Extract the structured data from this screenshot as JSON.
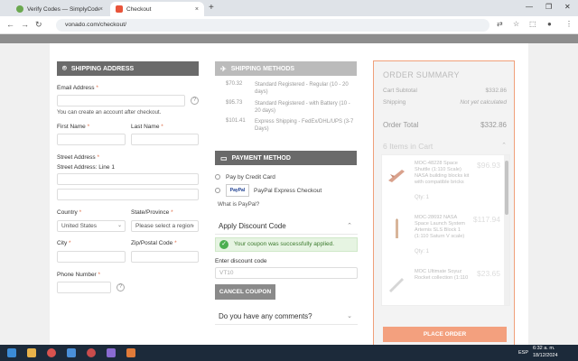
{
  "browser": {
    "tabs": [
      {
        "label": "Verify Codes — SimplyCodes",
        "close": "×"
      },
      {
        "label": "Checkout",
        "close": "×"
      }
    ],
    "new_tab": "+",
    "url": "vonado.com/checkout/"
  },
  "shipping_address": {
    "title": "SHIPPING ADDRESS",
    "email_label": "Email Address",
    "required_mark": "*",
    "account_note": "You can create an account after checkout.",
    "first_name_label": "First Name",
    "last_name_label": "Last Name",
    "street_label": "Street Address",
    "street_sublabel": "Street Address: Line 1",
    "country_label": "Country",
    "country_value": "United States",
    "state_label": "State/Province",
    "state_value": "Please select a region",
    "city_label": "City",
    "zip_label": "Zip/Postal Code",
    "phone_label": "Phone Number",
    "help": "?"
  },
  "shipping_methods": {
    "title": "SHIPPING METHODS",
    "options": [
      {
        "price": "$70.32",
        "desc": "Standard Registered - Regular (10 - 20 days)"
      },
      {
        "price": "$95.73",
        "desc": "Standard Registered - with Battery (10 - 20 days)"
      },
      {
        "price": "$101.41",
        "desc": "Express Shipping - FedEx/DHL/UPS (3-7 Days)"
      }
    ]
  },
  "payment": {
    "title": "PAYMENT METHOD",
    "credit_card": "Pay by Credit Card",
    "paypal": "PayPal Express Checkout",
    "paypal_logo": "PayPal",
    "what_is_paypal": "What is PayPal?"
  },
  "discount": {
    "title": "Apply Discount Code",
    "success": "Your coupon was successfully applied.",
    "enter_label": "Enter discount code",
    "code_value": "VT10",
    "cancel_button": "CANCEL COUPON"
  },
  "comments": {
    "title": "Do you have any comments?"
  },
  "summary": {
    "title": "ORDER SUMMARY",
    "subtotal_label": "Cart Subtotal",
    "subtotal_value": "$332.86",
    "shipping_label": "Shipping",
    "shipping_value": "Not yet calculated",
    "total_label": "Order Total",
    "total_value": "$332.86",
    "cart_heading": "6 Items in Cart",
    "items": [
      {
        "name": "MOC-48228 Space Shuttle (1:110 Scale) NASA building blocks kit with compatible bricks",
        "price": "$96.93",
        "qty": "Qty: 1"
      },
      {
        "name": "MOC-28692 NASA Space Launch System Artemis SLS Block 1 (1:110 Saturn V scale)",
        "price": "$117.94",
        "qty": "Qty: 1"
      },
      {
        "name": "MOC Ultimate Soyuz Rocket collection (1:110",
        "price": "$23.65",
        "qty": ""
      }
    ],
    "place_order": "PLACE ORDER"
  },
  "taskbar": {
    "lang": "ESP",
    "time": "6:32 a. m.",
    "date": "18/12/2024"
  }
}
